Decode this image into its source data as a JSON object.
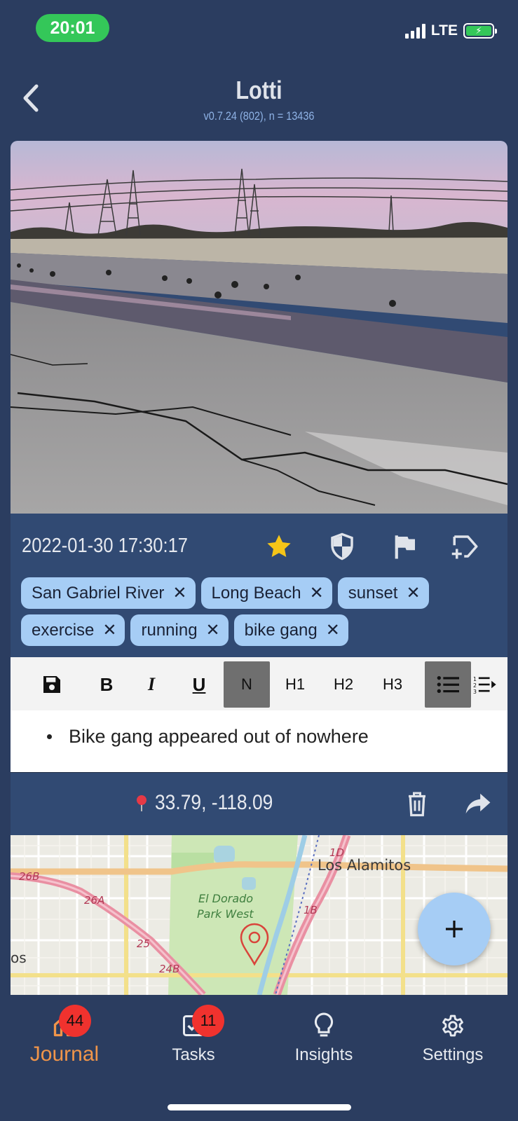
{
  "status_bar": {
    "time": "20:01",
    "network": "LTE"
  },
  "header": {
    "title": "Lotti",
    "subtitle": "v0.7.24 (802), n = 13436"
  },
  "entry": {
    "date": "2022-01-30 17:30:17",
    "starred": true,
    "tags": [
      "San Gabriel River",
      "Long Beach",
      "sunset",
      "exercise",
      "running",
      "bike gang"
    ],
    "toolbar": {
      "normal": "N",
      "h1": "H1",
      "h2": "H2",
      "h3": "H3",
      "bold": "B",
      "italic": "I",
      "underline": "U"
    },
    "text_bullet": "Bike gang appeared out of nowhere",
    "location": "33.79, -118.09",
    "map_labels": {
      "city": "Los Alamitos",
      "park_line1": "El Dorado",
      "park_line2": "Park West",
      "exit_26b": "26B",
      "exit_26a": "26A",
      "exit_25": "25",
      "exit_24b": "24B",
      "exit_1d": "1D",
      "exit_1b": "1B",
      "partial_los": "os"
    }
  },
  "fab": {
    "icon": "plus-icon"
  },
  "nav": {
    "items": [
      {
        "label": "Journal",
        "badge": "44",
        "icon": "home-icon",
        "active": true
      },
      {
        "label": "Tasks",
        "badge": "11",
        "icon": "checkbox-icon"
      },
      {
        "label": "Insights",
        "icon": "lightbulb-icon"
      },
      {
        "label": "Settings",
        "icon": "gear-icon"
      }
    ]
  },
  "colors": {
    "background": "#2b3d60",
    "card": "#314a73",
    "tag": "#a6cdf5",
    "active_nav": "#f0954a",
    "badge": "#f0322e",
    "star": "#f5c518"
  }
}
